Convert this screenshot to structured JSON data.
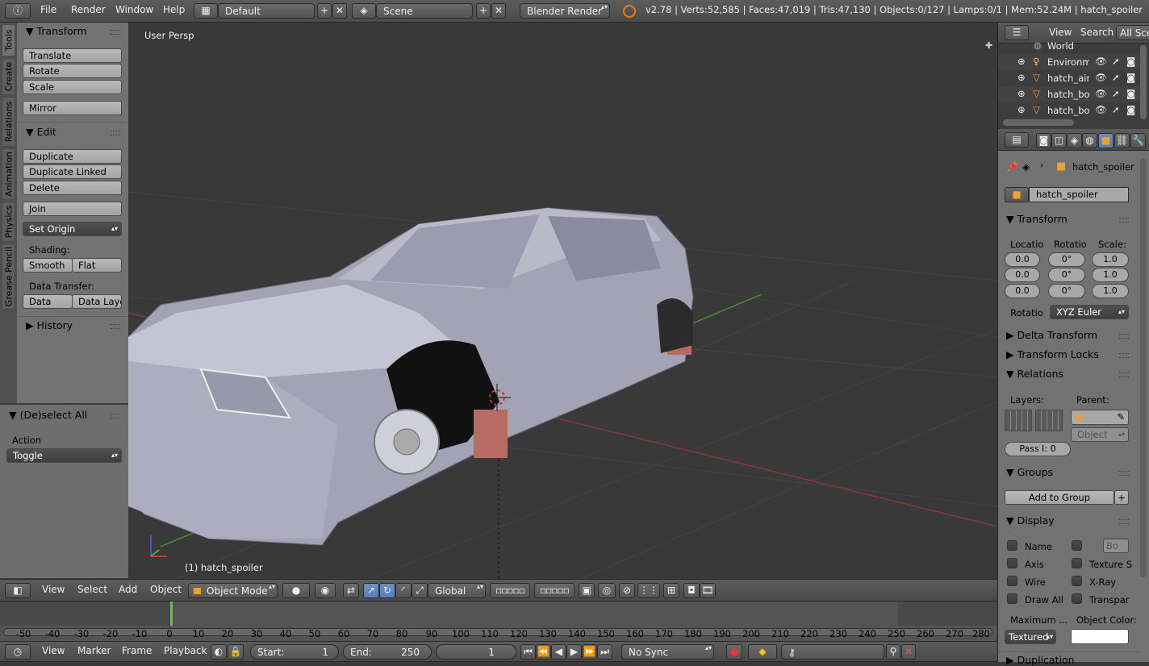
{
  "topbar": {
    "menus": [
      "File",
      "Render",
      "Window",
      "Help"
    ],
    "layout": "Default",
    "scene": "Scene",
    "engine": "Blender Render",
    "stats": "v2.78 | Verts:52,585 | Faces:47,019 | Tris:47,130 | Objects:0/127 | Lamps:0/1 | Mem:52.24M | hatch_spoiler"
  },
  "tool_tabs": [
    "Tools",
    "Create",
    "Relations",
    "Animation",
    "Physics",
    "Grease Pencil"
  ],
  "toolshelf": {
    "transform": {
      "title": "Transform",
      "buttons": [
        "Translate",
        "Rotate",
        "Scale",
        "Mirror"
      ]
    },
    "edit": {
      "title": "Edit",
      "buttons": [
        "Duplicate",
        "Duplicate Linked",
        "Delete",
        "Join"
      ],
      "set_origin": "Set Origin",
      "shading_label": "Shading:",
      "smooth": "Smooth",
      "flat": "Flat",
      "data_transfer_label": "Data Transfer:",
      "data": "Data",
      "data_layo": "Data Layo"
    },
    "history": "History"
  },
  "operator": {
    "title": "(De)select All",
    "action_label": "Action",
    "action_value": "Toggle"
  },
  "viewport": {
    "view_name": "User Persp",
    "object_label": "(1) hatch_spoiler"
  },
  "viewport_header": {
    "menus": [
      "View",
      "Select",
      "Add",
      "Object"
    ],
    "mode": "Object Mode",
    "orientation": "Global"
  },
  "outliner": {
    "menus": [
      "View",
      "Search"
    ],
    "filter": "All Scen",
    "items": [
      {
        "name": "World",
        "icon": "world-icon"
      },
      {
        "name": "Environme",
        "icon": "lamp-icon"
      },
      {
        "name": "hatch_airt",
        "icon": "mesh-icon"
      },
      {
        "name": "hatch_boc",
        "icon": "mesh-icon"
      },
      {
        "name": "hatch_boc",
        "icon": "mesh-icon"
      }
    ]
  },
  "properties": {
    "breadcrumb": "hatch_spoiler",
    "object_name": "hatch_spoiler",
    "transform": {
      "title": "Transform",
      "location_label": "Locatio",
      "rotation_label": "Rotatio",
      "scale_label": "Scale:",
      "location": [
        "0.0",
        "0.0",
        "0.0"
      ],
      "rotation": [
        "0°",
        "0°",
        "0°"
      ],
      "scale": [
        "1.0",
        "1.0",
        "1.0"
      ],
      "rotation_mode_label": "Rotatio",
      "rotation_mode": "XYZ Euler"
    },
    "delta_transform": "Delta Transform",
    "transform_locks": "Transform Locks",
    "relations": {
      "title": "Relations",
      "layers_label": "Layers:",
      "parent_label": "Parent:",
      "parent_type": "Object",
      "pass_index": "Pass I: 0"
    },
    "groups": {
      "title": "Groups",
      "add_button": "Add to Group"
    },
    "display": {
      "title": "Display",
      "left": [
        "Name",
        "Axis",
        "Wire",
        "Draw All"
      ],
      "right": [
        "Bo",
        "Texture S",
        "X-Ray",
        "Transpar"
      ],
      "max_label": "Maximum ...",
      "color_label": "Object Color:",
      "max_value": "Textured",
      "object_color": "#ffffff"
    },
    "duplication": "Duplication"
  },
  "timeline": {
    "ticks": [
      "-50",
      "-40",
      "-30",
      "-20",
      "-10",
      "0",
      "10",
      "20",
      "30",
      "40",
      "50",
      "60",
      "70",
      "80",
      "90",
      "100",
      "110",
      "120",
      "130",
      "140",
      "150",
      "160",
      "170",
      "180",
      "190",
      "200",
      "210",
      "220",
      "230",
      "240",
      "250",
      "260",
      "270",
      "280"
    ],
    "current_frame_marker": "1",
    "menus": [
      "View",
      "Marker",
      "Frame",
      "Playback"
    ],
    "start_label": "Start:",
    "start_value": "1",
    "end_label": "End:",
    "end_value": "250",
    "current_frame": "1",
    "sync": "No Sync"
  }
}
